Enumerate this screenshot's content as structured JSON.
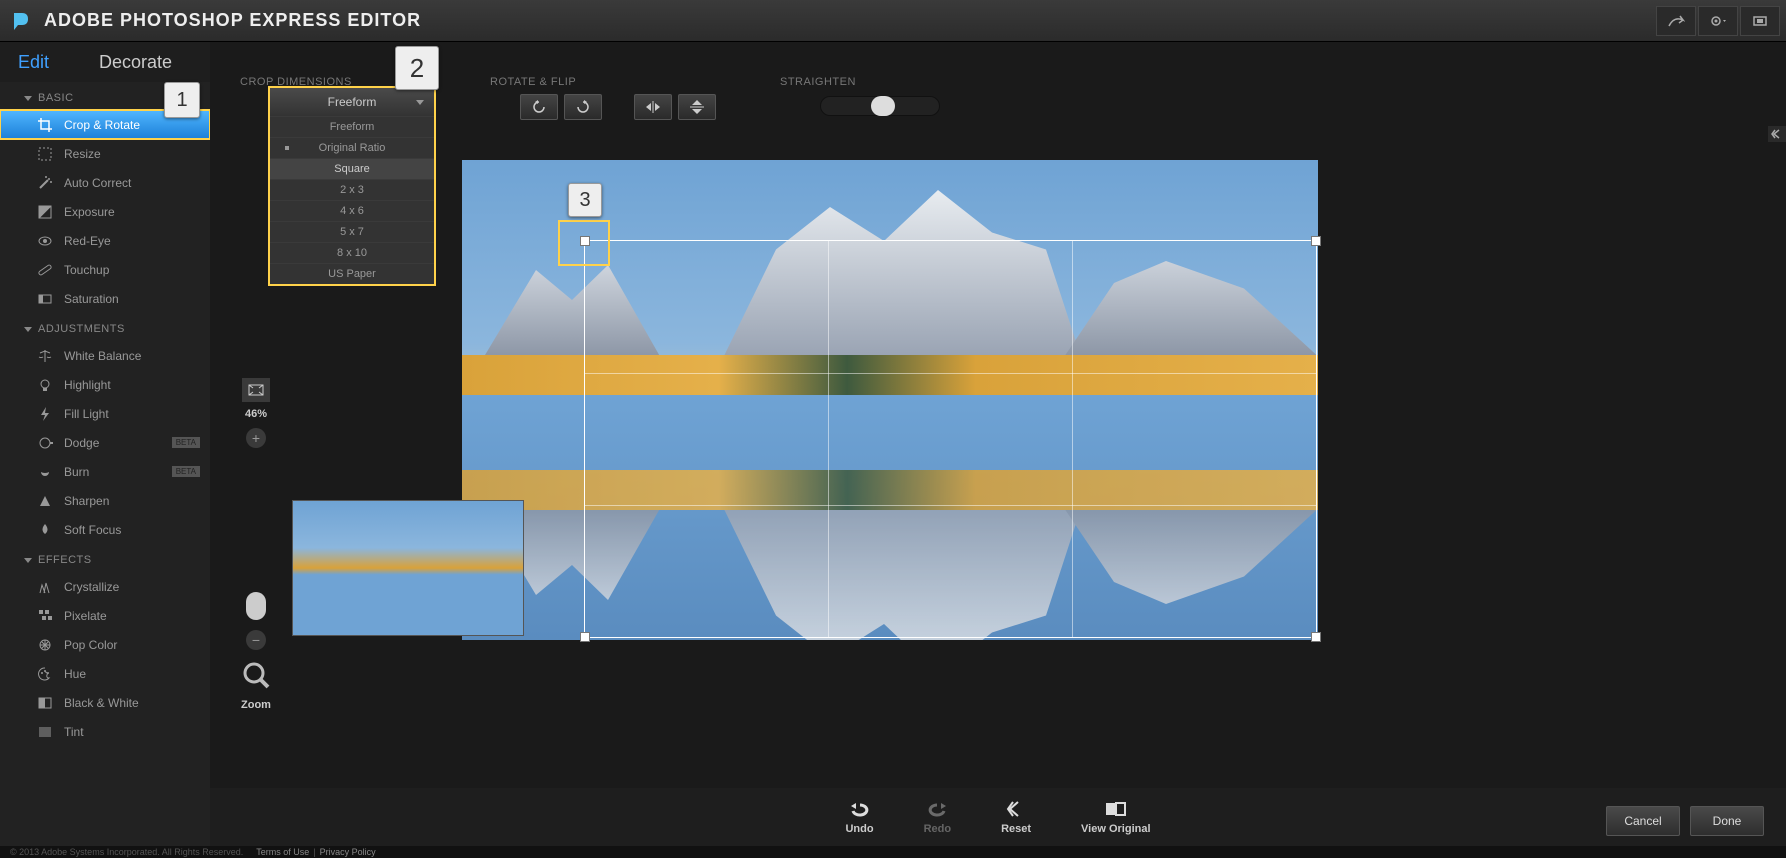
{
  "app": {
    "title": "ADOBE PHOTOSHOP EXPRESS EDITOR"
  },
  "tabs": {
    "edit": "Edit",
    "decorate": "Decorate"
  },
  "sidebar": {
    "groups": [
      {
        "label": "BASIC",
        "items": [
          {
            "label": "Crop & Rotate",
            "icon": "crop-icon",
            "active": true
          },
          {
            "label": "Resize",
            "icon": "resize-icon"
          },
          {
            "label": "Auto Correct",
            "icon": "wand-icon"
          },
          {
            "label": "Exposure",
            "icon": "exposure-icon"
          },
          {
            "label": "Red-Eye",
            "icon": "eye-icon"
          },
          {
            "label": "Touchup",
            "icon": "bandage-icon"
          },
          {
            "label": "Saturation",
            "icon": "saturation-icon"
          }
        ]
      },
      {
        "label": "ADJUSTMENTS",
        "items": [
          {
            "label": "White Balance",
            "icon": "balance-icon"
          },
          {
            "label": "Highlight",
            "icon": "bulb-icon"
          },
          {
            "label": "Fill Light",
            "icon": "flash-icon"
          },
          {
            "label": "Dodge",
            "icon": "dodge-icon",
            "beta": "BETA"
          },
          {
            "label": "Burn",
            "icon": "burn-icon",
            "beta": "BETA"
          },
          {
            "label": "Sharpen",
            "icon": "triangle-icon"
          },
          {
            "label": "Soft Focus",
            "icon": "drop-icon"
          }
        ]
      },
      {
        "label": "EFFECTS",
        "items": [
          {
            "label": "Crystallize",
            "icon": "crystal-icon"
          },
          {
            "label": "Pixelate",
            "icon": "pixelate-icon"
          },
          {
            "label": "Pop Color",
            "icon": "popcolor-icon"
          },
          {
            "label": "Hue",
            "icon": "palette-icon"
          },
          {
            "label": "Black & White",
            "icon": "bw-icon"
          },
          {
            "label": "Tint",
            "icon": "tint-icon"
          }
        ]
      }
    ]
  },
  "sections": {
    "crop": "CROP DIMENSIONS",
    "rotate": "ROTATE & FLIP",
    "straighten": "STRAIGHTEN"
  },
  "crop_dropdown": {
    "selected": "Freeform",
    "options": [
      "Freeform",
      "Original Ratio",
      "Square",
      "2 x 3",
      "4 x 6",
      "5 x 7",
      "8 x 10",
      "US Paper"
    ],
    "hover_index": 2,
    "current_index": 1
  },
  "zoom": {
    "percent": "46%",
    "label": "Zoom"
  },
  "bottombar": {
    "undo": "Undo",
    "redo": "Redo",
    "reset": "Reset",
    "view_original": "View Original"
  },
  "buttons": {
    "cancel": "Cancel",
    "done": "Done"
  },
  "callouts": {
    "one": "1",
    "two": "2",
    "three": "3"
  },
  "footer": {
    "copyright": "© 2013 Adobe Systems Incorporated. All Rights Reserved.",
    "terms": "Terms of Use",
    "sep": "|",
    "privacy": "Privacy Policy"
  }
}
